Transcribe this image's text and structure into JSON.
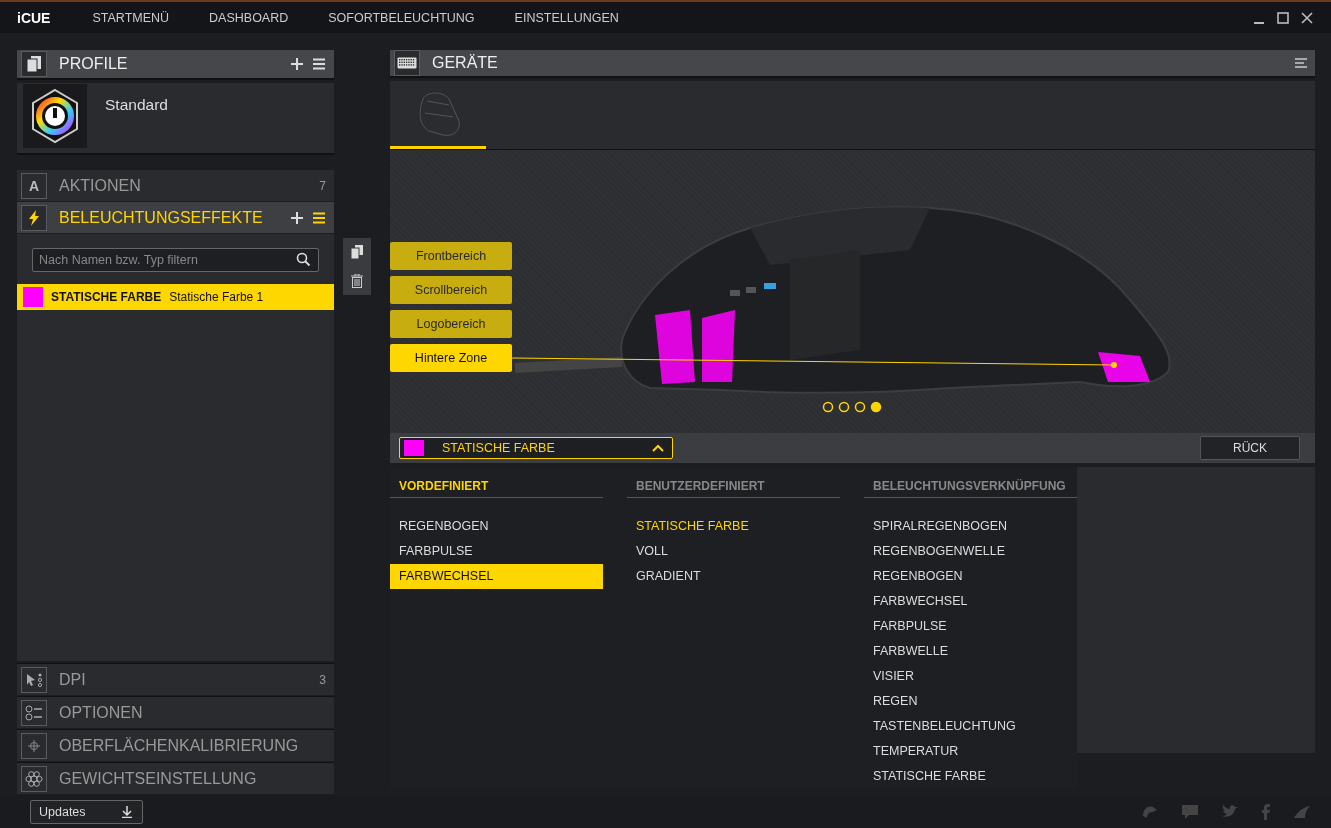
{
  "nav": {
    "logo": "iCUE",
    "items": [
      {
        "label": "STARTMENÜ"
      },
      {
        "label": "DASHBOARD"
      },
      {
        "label": "SOFORTBELEUCHTUNG"
      },
      {
        "label": "EINSTELLUNGEN"
      }
    ]
  },
  "profiles": {
    "title": "PROFILE",
    "items": [
      {
        "name": "Standard"
      }
    ]
  },
  "sections_top": [
    {
      "kind": "actions",
      "icon_letter": "A",
      "title": "AKTIONEN",
      "count": "7",
      "selected": false
    },
    {
      "kind": "lighting",
      "title": "BELEUCHTUNGSEFFEKTE",
      "selected": true
    }
  ],
  "lighting": {
    "search": {
      "placeholder": "Nach Namen bzw. Typ filtern"
    },
    "effects": [
      {
        "type": "STATISCHE FARBE",
        "name": "Statische Farbe 1",
        "color": "#ff00ff",
        "selected": true
      }
    ]
  },
  "sections_bottom": [
    {
      "kind": "dpi",
      "title": "DPI",
      "count": "3",
      "selected": false
    },
    {
      "kind": "options",
      "title": "OPTIONEN",
      "selected": false
    },
    {
      "kind": "calibration",
      "title": "OBERFLÄCHENKALIBRIERUNG",
      "selected": false
    },
    {
      "kind": "weight",
      "title": "GEWICHTSEINSTELLUNG",
      "selected": false
    }
  ],
  "devices": {
    "title": "GERÄTE",
    "items": [
      {
        "selected": true
      }
    ]
  },
  "zones": [
    {
      "label": "Frontbereich",
      "selected": false
    },
    {
      "label": "Scrollbereich",
      "selected": false
    },
    {
      "label": "Logobereich",
      "selected": false
    },
    {
      "label": "Hintere Zone",
      "selected": true
    }
  ],
  "pages": [
    {
      "selected": false
    },
    {
      "selected": false
    },
    {
      "selected": false
    },
    {
      "selected": true
    }
  ],
  "effect_picker": {
    "label": "STATISCHE FARBE",
    "color": "#ff00ff",
    "expanded": true
  },
  "back_button": "RÜCK",
  "effect_menu": [
    {
      "title": "VORDEFINIERT",
      "selected": true,
      "items": [
        {
          "label": "REGENBOGEN",
          "selected": false,
          "active": false
        },
        {
          "label": "FARBPULSE",
          "selected": false,
          "active": false
        },
        {
          "label": "FARBWECHSEL",
          "selected": true,
          "active": false
        }
      ]
    },
    {
      "title": "BENUTZERDEFINIERT",
      "selected": false,
      "items": [
        {
          "label": "STATISCHE FARBE",
          "selected": false,
          "active": true
        },
        {
          "label": "VOLL",
          "selected": false,
          "active": false
        },
        {
          "label": "GRADIENT",
          "selected": false,
          "active": false
        }
      ]
    },
    {
      "title": "BELEUCHTUNGSVERKNÜPFUNG",
      "selected": false,
      "items": [
        {
          "label": "SPIRALREGENBOGEN",
          "selected": false,
          "active": false
        },
        {
          "label": "REGENBOGENWELLE",
          "selected": false,
          "active": false
        },
        {
          "label": "REGENBOGEN",
          "selected": false,
          "active": false
        },
        {
          "label": "FARBWECHSEL",
          "selected": false,
          "active": false
        },
        {
          "label": "FARBPULSE",
          "selected": false,
          "active": false
        },
        {
          "label": "FARBWELLE",
          "selected": false,
          "active": false
        },
        {
          "label": "VISIER",
          "selected": false,
          "active": false
        },
        {
          "label": "REGEN",
          "selected": false,
          "active": false
        },
        {
          "label": "TASTENBELEUCHTUNG",
          "selected": false,
          "active": false
        },
        {
          "label": "TEMPERATUR",
          "selected": false,
          "active": false
        },
        {
          "label": "STATISCHE FARBE",
          "selected": false,
          "active": false
        }
      ]
    }
  ],
  "footer": {
    "updates": "Updates"
  }
}
